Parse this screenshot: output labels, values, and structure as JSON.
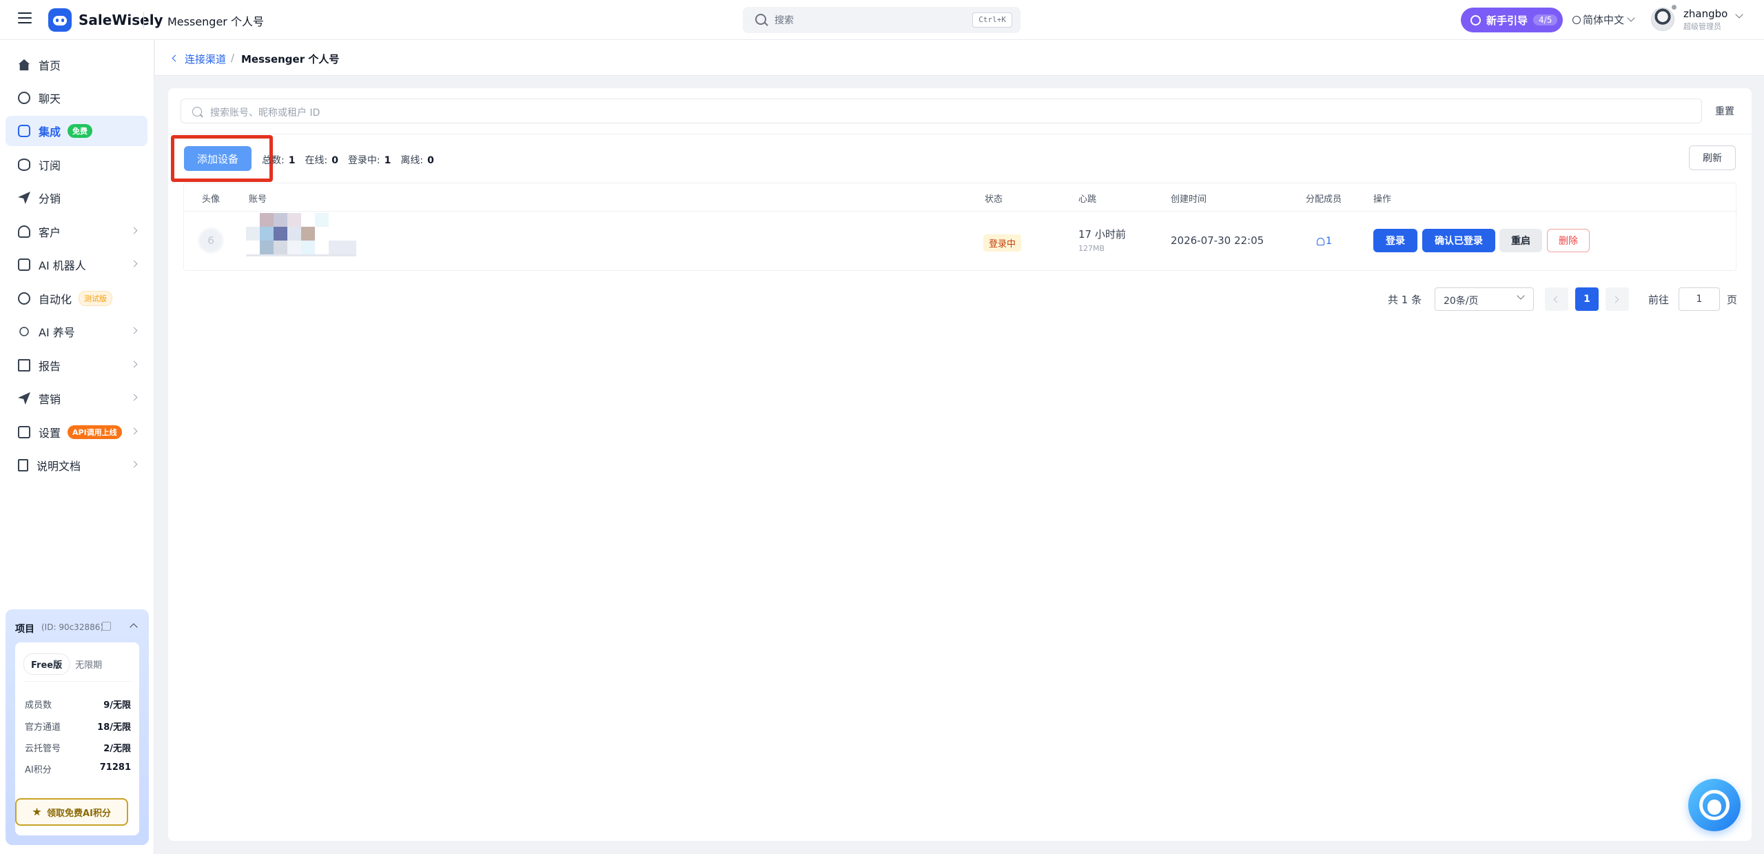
{
  "header": {
    "brand": "SaleWisely",
    "page_name": "Messenger 个人号",
    "search_placeholder": "搜索",
    "search_shortcut": "Ctrl+K",
    "guide_label": "新手引导",
    "guide_progress": "4/5",
    "language": "简体中文",
    "user_name": "zhangbo",
    "user_role": "超级管理员"
  },
  "sidebar": {
    "items": [
      {
        "label": "首页",
        "icon": "home-icon"
      },
      {
        "label": "聊天",
        "icon": "chat-icon"
      },
      {
        "label": "集成",
        "icon": "integration-icon",
        "badge": "免费",
        "active": true
      },
      {
        "label": "订阅",
        "icon": "database-icon"
      },
      {
        "label": "分销",
        "icon": "send-icon"
      },
      {
        "label": "客户",
        "icon": "user-icon"
      },
      {
        "label": "AI 机器人",
        "icon": "robot-icon"
      },
      {
        "label": "自动化",
        "icon": "automation-icon",
        "badge": "测试版"
      },
      {
        "label": "AI 养号",
        "icon": "sun-icon"
      },
      {
        "label": "报告",
        "icon": "report-icon"
      },
      {
        "label": "营销",
        "icon": "send-icon"
      },
      {
        "label": "设置",
        "icon": "settings-icon",
        "badge": "API调用上线"
      },
      {
        "label": "说明文档",
        "icon": "doc-icon"
      }
    ],
    "project": {
      "title": "项目",
      "id": "(ID: 90c32886)",
      "plan": "Free版",
      "expiry": "无限期",
      "stats": [
        {
          "label": "成员数",
          "value": "9/无限"
        },
        {
          "label": "官方通道",
          "value": "18/无限"
        },
        {
          "label": "云托管号",
          "value": "2/无限"
        },
        {
          "label": "AI积分",
          "value": "71281"
        }
      ],
      "claim_label": "领取免费AI积分"
    }
  },
  "breadcrumb": {
    "parent": "连接渠道",
    "separator": "/",
    "current": "Messenger 个人号"
  },
  "toolbar": {
    "filter_placeholder": "搜索账号、昵称或租户 ID",
    "reset_label": "重置",
    "add_device_label": "添加设备",
    "counts": [
      {
        "label": "总数:",
        "value": "1"
      },
      {
        "label": "在线:",
        "value": "0"
      },
      {
        "label": "登录中:",
        "value": "1"
      },
      {
        "label": "离线:",
        "value": "0"
      }
    ],
    "refresh_label": "刷新"
  },
  "table": {
    "columns": [
      "头像",
      "账号",
      "状态",
      "心跳",
      "创建时间",
      "分配成员",
      "操作"
    ],
    "rows": [
      {
        "avatar_initial": "6",
        "status": "登录中",
        "heartbeat": "17 小时前",
        "heartbeat_sub": "127MB",
        "created": "2026-07-30 22:05",
        "members": "1",
        "actions": [
          "登录",
          "确认已登录",
          "重启",
          "删除"
        ]
      }
    ]
  },
  "pagination": {
    "total": "共 1 条",
    "page_size": "20条/页",
    "current_page": "1",
    "goto_label": "前往",
    "goto_value": "1",
    "page_suffix": "页"
  },
  "colors": {
    "primary": "#2563eb",
    "guide": "#7c5cf6",
    "highlight_border": "#e3311f"
  }
}
